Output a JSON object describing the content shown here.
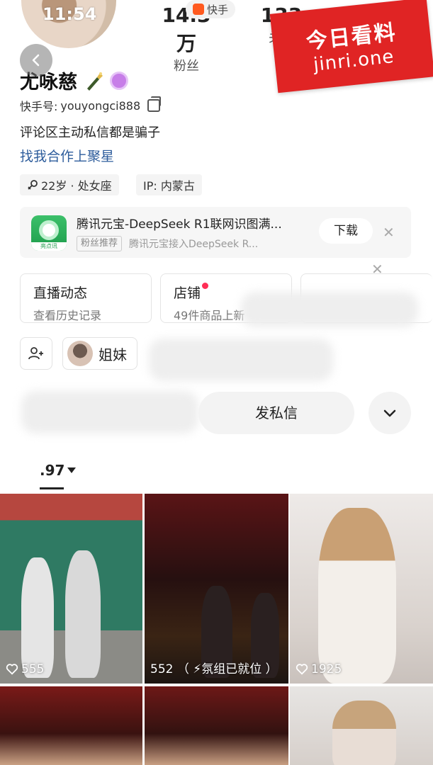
{
  "status": {
    "time": "11:54"
  },
  "platform_badge": "快手",
  "watermark": {
    "cn": "今日看料",
    "en": "jinri.one"
  },
  "stats": {
    "fans_value": "14.3万",
    "fans_label": "粉丝",
    "follow_value": "133",
    "follow_label": "关注"
  },
  "profile": {
    "name": "尤咏慈",
    "account_label": "快手号:",
    "account_id": "youyongci888",
    "bio": "评论区主动私信都是骗子",
    "coop_link": "找我合作上聚星",
    "tags": {
      "age": "22岁 · 处女座",
      "ip": "IP: 内蒙古"
    }
  },
  "ad": {
    "title": "腾讯元宝-DeepSeek R1联网识图满...",
    "tag": "粉丝推荐",
    "subtitle": "腾讯元宝接入DeepSeek R...",
    "logo_text": "亮点讯",
    "download_label": "下载"
  },
  "feature_cards": {
    "live_title": "直播动态",
    "live_sub": "查看历史记录",
    "shop_title": "店铺",
    "shop_sub": "49件商品上新"
  },
  "friends": {
    "sister_label": "姐妹"
  },
  "actions": {
    "pm_label": "发私信"
  },
  "tab": {
    "works_label": ".97"
  },
  "videos": [
    {
      "likes": "555"
    },
    {
      "likes": "552",
      "caption": "（ ⚡氛组已就位 ）"
    },
    {
      "likes": "1925"
    }
  ],
  "colors": {
    "brand_orange": "#ff5a1f",
    "link_blue": "#2e5d9c",
    "notify_red": "#ff2d55",
    "watermark_red": "#e02424"
  }
}
